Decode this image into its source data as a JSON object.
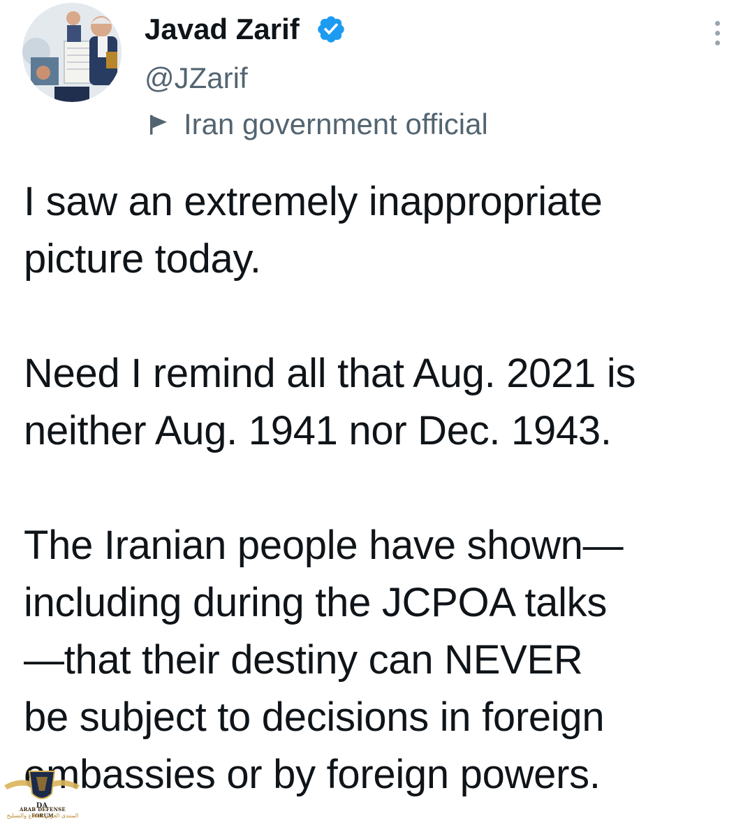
{
  "author": {
    "display_name": "Javad Zarif",
    "handle": "@JZarif",
    "verified": true,
    "verified_icon": "verified-badge-icon",
    "label_icon": "flag-icon",
    "label": "Iran government official",
    "avatar_icon": "profile-avatar"
  },
  "menu": {
    "icon": "more-options-icon"
  },
  "tweet": {
    "paragraphs": [
      "I saw an extremely inappropriate\npicture today.",
      "Need I remind all that Aug. 2021 is\nneither Aug. 1941 nor Dec. 1943.",
      "The Iranian people have shown—\nincluding during the JCPOA talks\n—that their destiny can NEVER\nbe subject to decisions in foreign\nembassies or by foreign powers."
    ]
  },
  "watermark": {
    "monogram": "DA",
    "name": "ARAB DEFENSE FORUM",
    "arabic": "المنتدى العربي للدفاع والتسليح"
  },
  "colors": {
    "text": "#0f1419",
    "secondary": "#536471",
    "verified_blue": "#1d9bf0",
    "background": "#ffffff"
  }
}
